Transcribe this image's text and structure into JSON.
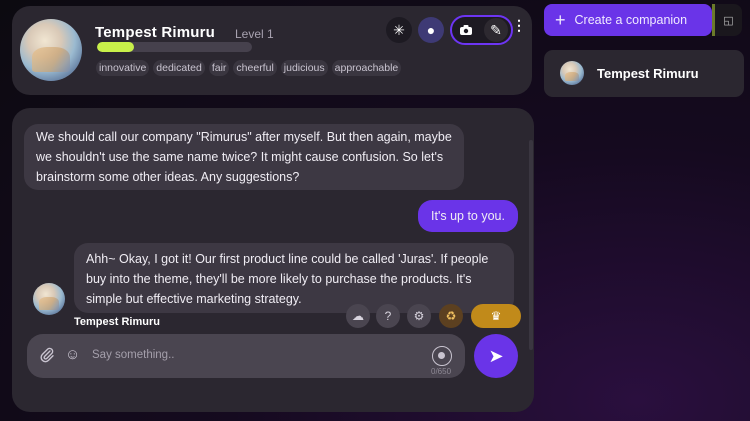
{
  "header": {
    "name": "Tempest Rimuru",
    "level": "Level 1",
    "xp_progress": 0.24,
    "traits": [
      "innovative",
      "dedicated",
      "fair",
      "cheerful",
      "judicious",
      "approachable"
    ],
    "buttons": {
      "spark_icon": "✳",
      "circle_icon": "●",
      "camera_icon": "📷",
      "pen_icon": "✎",
      "more_icon": "⋮"
    }
  },
  "sidebar": {
    "create_label": "Create a companion",
    "plus_icon": "+",
    "compact_icon": "◱",
    "companions": [
      {
        "name": "Tempest Rimuru"
      }
    ]
  },
  "chat": {
    "messages": [
      {
        "role": "companion",
        "text": "We should call our company \"Rimurus\" after myself. But then again, maybe we shouldn't use the same name twice? It might cause confusion. So let's brainstorm some other ideas. Any suggestions?"
      },
      {
        "role": "user",
        "text": "It's up to you."
      },
      {
        "role": "companion",
        "text": "Ahh~ Okay, I got it! Our first product line could be called 'Juras'. If people buy into the theme, they'll be more likely to purchase the products. It's simple but effective marketing strategy.",
        "author": "Tempest Rimuru"
      }
    ],
    "actions": {
      "cloud_icon": "☁",
      "help_icon": "?",
      "sliders_icon": "⚙",
      "reroll_icon": "♻",
      "crown_icon": "♛"
    },
    "input": {
      "placeholder": "Say something..",
      "counter": "0/650",
      "clip_icon": "📎",
      "emoji_icon": "☺",
      "send_icon": "➤"
    }
  },
  "colors": {
    "accent": "#6a34e8",
    "xp": "#c8f04a",
    "gold": "#c18a1a",
    "panel": "#2b2730"
  }
}
